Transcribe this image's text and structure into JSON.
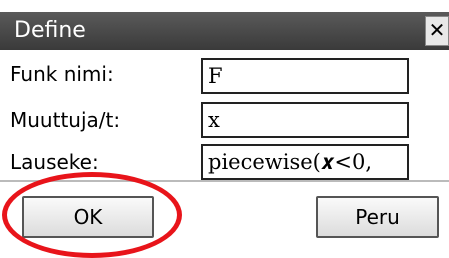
{
  "dialog": {
    "title": "Define",
    "close_glyph": "✕"
  },
  "fields": [
    {
      "label": "Funk nimi:",
      "value": "F"
    },
    {
      "label": "Muuttuja/t:",
      "value": "x"
    },
    {
      "label": "Lauseke:",
      "value": "piecewise(𝒙<0,"
    }
  ],
  "buttons": {
    "ok_label": "OK",
    "cancel_label": "Peru"
  },
  "annotation": {
    "highlight_color": "#e8141a",
    "highlight_target": "ok-button"
  },
  "colors": {
    "titlebar": "#4a4a4a"
  }
}
